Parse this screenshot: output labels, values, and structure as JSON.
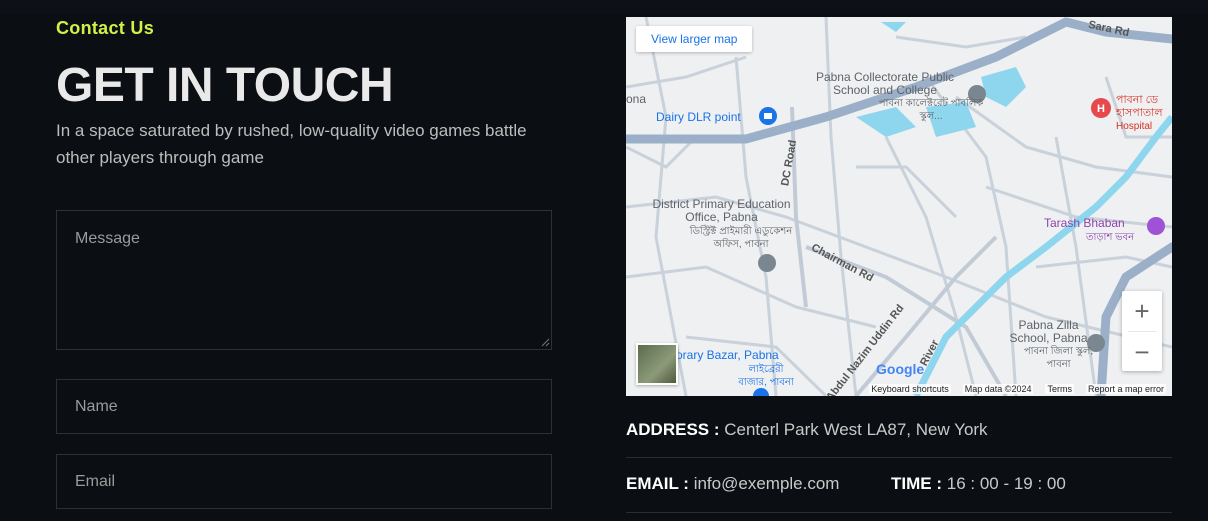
{
  "section": {
    "eyebrow": "Contact Us",
    "title": "GET IN TOUCH",
    "subtitle": "In a space saturated by rushed, low-quality video games battle other players through game"
  },
  "form": {
    "message_placeholder": "Message",
    "name_placeholder": "Name",
    "email_placeholder": "Email"
  },
  "map": {
    "view_larger_label": "View larger map",
    "zoom_in_label": "+",
    "zoom_out_label": "−",
    "google_label": "Google",
    "attribution": {
      "shortcuts": "Keyboard shortcuts",
      "data": "Map data ©2024",
      "terms": "Terms",
      "report": "Report a map error"
    },
    "places": {
      "collectorate_en": "Pabna Collectorate Public School and College",
      "collectorate_bn": "পাবনা কালেক্টরেট পাবলিক স্কুল...",
      "dairy": "Dairy DLR point",
      "district_en": "District Primary Education Office, Pabna",
      "district_bn": "ডিস্ট্রিক্ট প্রাইমারী এডুকেশন অফিস, পাবনা",
      "tarash_en": "Tarash Bhaban",
      "tarash_bn": "তাড়াশ ভবন",
      "hospital_bn": "পাবনা ডে হাসপাতাল",
      "hospital_en": "Hospital",
      "zilla_en": "Pabna Zilla School, Pabna",
      "zilla_bn": "পাবনা জিলা স্কুল, পাবনা",
      "library_en": "orary Bazar, Pabna",
      "library_bn": "লাইব্রেরী বাজার, পাবনা",
      "edge_ona": "ona"
    },
    "roads": {
      "sara": "Sara Rd",
      "dc": "DC Road",
      "chairman": "Chairman Rd",
      "nazim": "Abdul Nazim Uddin Rd",
      "river": "River"
    },
    "colors": {
      "water": "#8ed6ee",
      "main_road": "#9bb0c8",
      "road": "#c9d1da",
      "background": "#eef0f2"
    }
  },
  "contact": {
    "address_label": "ADDRESS :",
    "address_value": "Centerl Park West LA87, New York",
    "email_label": "EMAIL :",
    "email_value": "info@exemple.com",
    "time_label": "TIME :",
    "time_value": "16 : 00 - 19 : 00"
  },
  "colors": {
    "accent": "#d4f046",
    "background": "#0b0e13",
    "border": "#2e3035"
  }
}
